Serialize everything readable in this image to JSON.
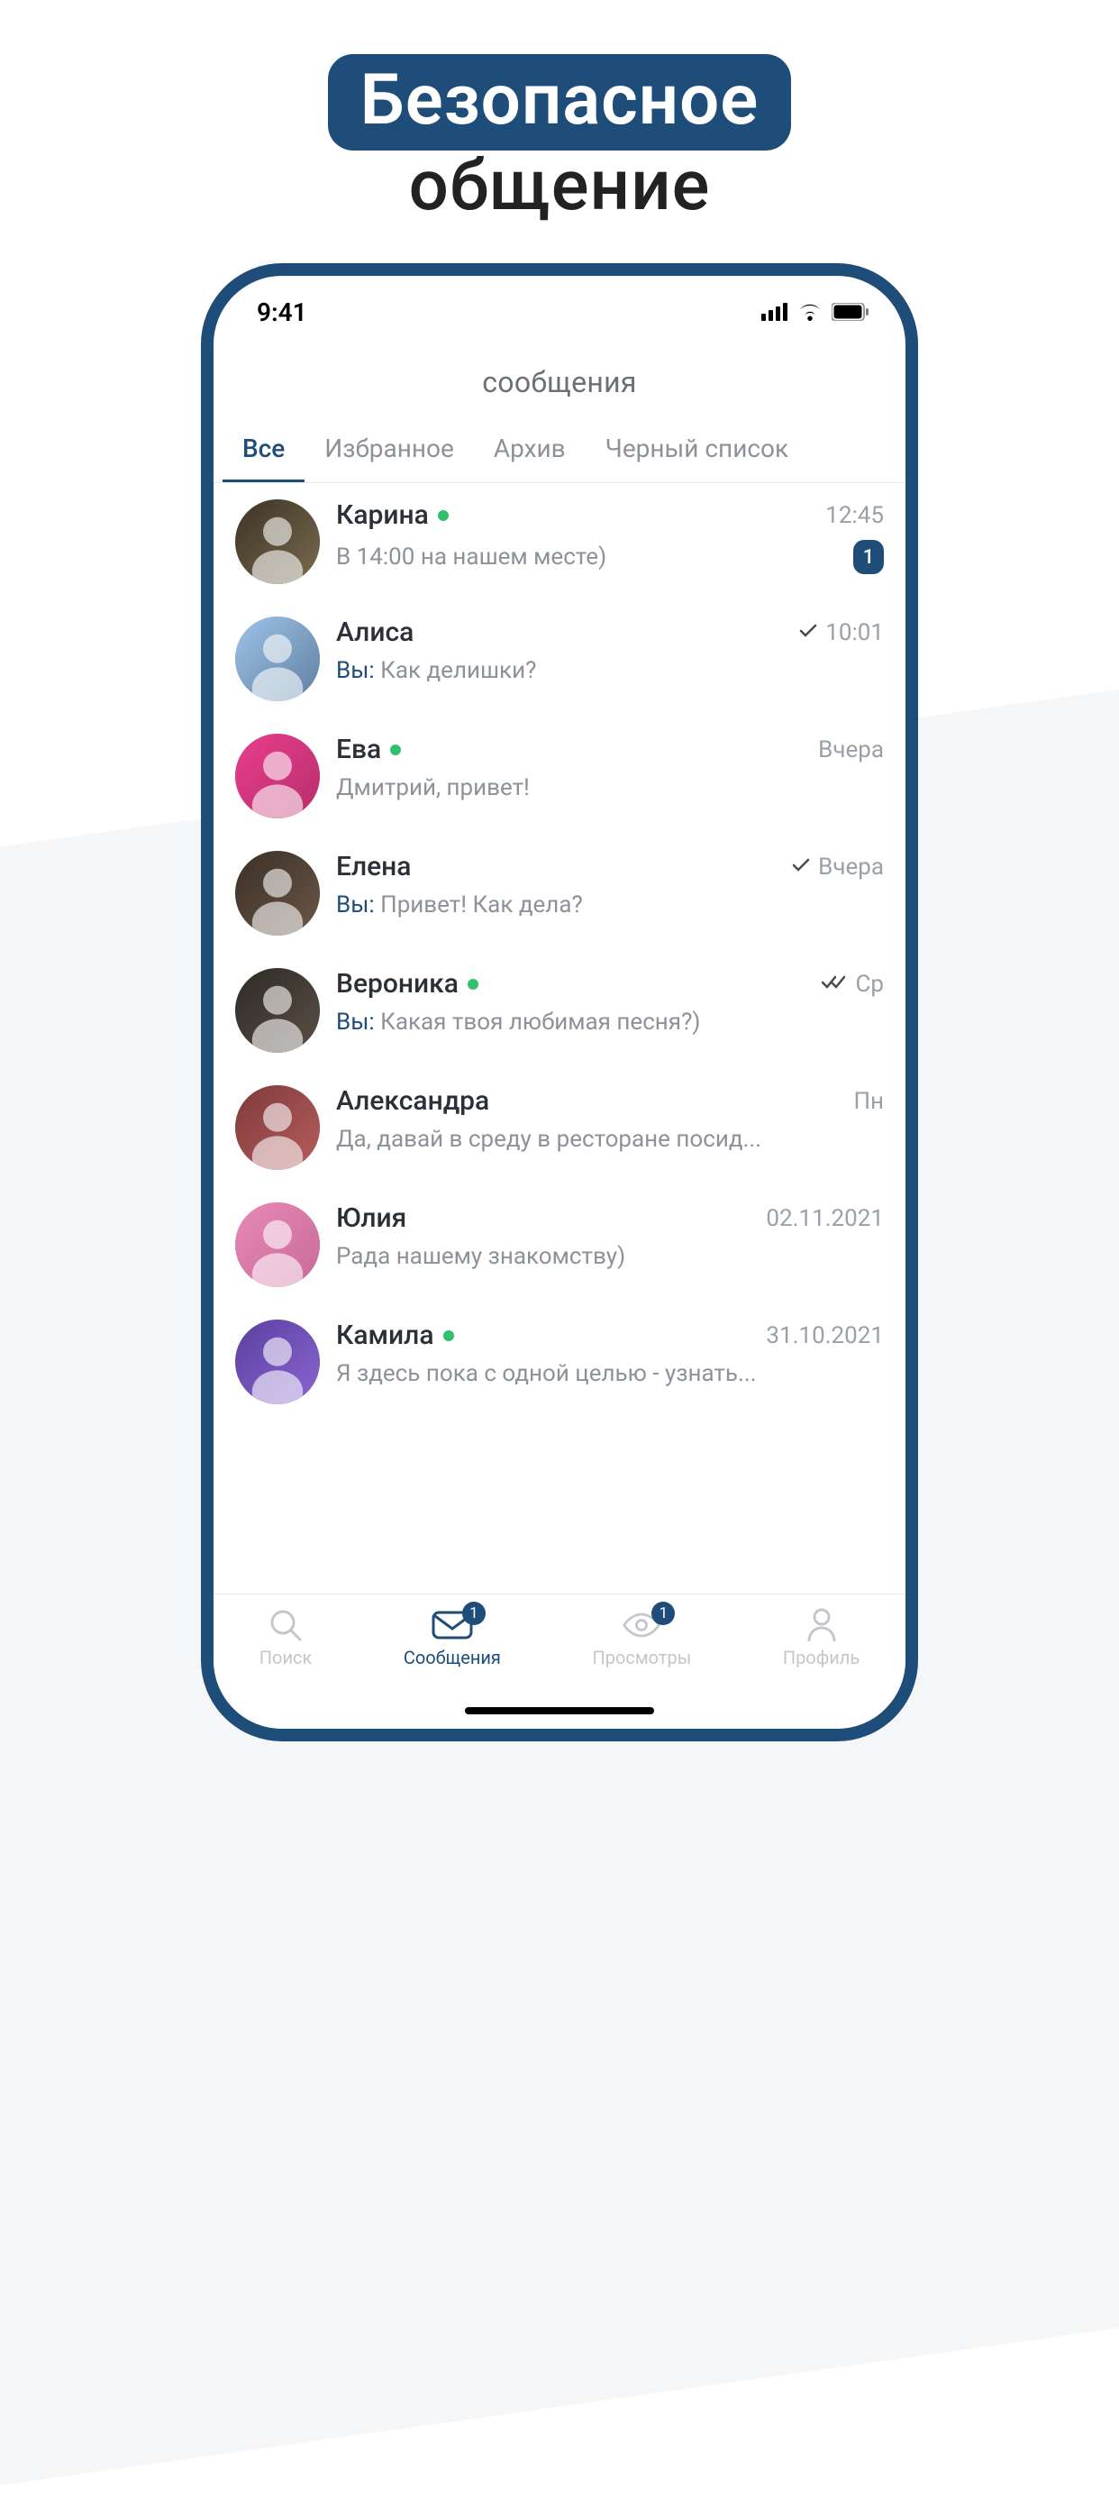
{
  "promo": {
    "top": "Безопасное",
    "bottom": "общение"
  },
  "status": {
    "time": "9:41"
  },
  "header": {
    "title": "сообщения"
  },
  "tabs": [
    {
      "label": "Все",
      "active": true
    },
    {
      "label": "Избранное",
      "active": false
    },
    {
      "label": "Архив",
      "active": false
    },
    {
      "label": "Черный список",
      "active": false
    }
  ],
  "you_prefix": "Вы:",
  "chats": [
    {
      "name": "Карина",
      "online": true,
      "time": "12:45",
      "preview": "В 14:00 на нашем месте)",
      "outgoing": false,
      "unread": "1",
      "status": ""
    },
    {
      "name": "Алиса",
      "online": false,
      "time": "10:01",
      "preview": "Как делишки?",
      "outgoing": true,
      "unread": "",
      "status": "sent"
    },
    {
      "name": "Ева",
      "online": true,
      "time": "Вчера",
      "preview": "Дмитрий, привет!",
      "outgoing": false,
      "unread": "",
      "status": ""
    },
    {
      "name": "Елена",
      "online": false,
      "time": "Вчера",
      "preview": "Привет! Как дела?",
      "outgoing": true,
      "unread": "",
      "status": "sent"
    },
    {
      "name": "Вероника",
      "online": true,
      "time": "Ср",
      "preview": "Какая твоя любимая песня?)",
      "outgoing": true,
      "unread": "",
      "status": "read"
    },
    {
      "name": "Александра",
      "online": false,
      "time": "Пн",
      "preview": "Да, давай в среду в ресторане посид...",
      "outgoing": false,
      "unread": "",
      "status": ""
    },
    {
      "name": "Юлия",
      "online": false,
      "time": "02.11.2021",
      "preview": "Рада нашему знакомству)",
      "outgoing": false,
      "unread": "",
      "status": ""
    },
    {
      "name": "Камила",
      "online": true,
      "time": "31.10.2021",
      "preview": "Я здесь пока с одной целью - узнать...",
      "outgoing": false,
      "unread": "",
      "status": ""
    }
  ],
  "tabbar": {
    "search": "Поиск",
    "messages": "Сообщения",
    "views": "Просмотры",
    "profile": "Профиль",
    "messages_badge": "1",
    "views_badge": "1"
  },
  "avatar_colors": [
    [
      "#3d3326",
      "#7a6b4e"
    ],
    [
      "#9fc4e8",
      "#5f7fa0"
    ],
    [
      "#e83e8c",
      "#b82e6c"
    ],
    [
      "#3a2f28",
      "#6b5847"
    ],
    [
      "#2e2a26",
      "#5a4f45"
    ],
    [
      "#7e3b3b",
      "#b85c5c"
    ],
    [
      "#e88ab8",
      "#c76a98"
    ],
    [
      "#5b3fa0",
      "#8a66d0"
    ]
  ]
}
